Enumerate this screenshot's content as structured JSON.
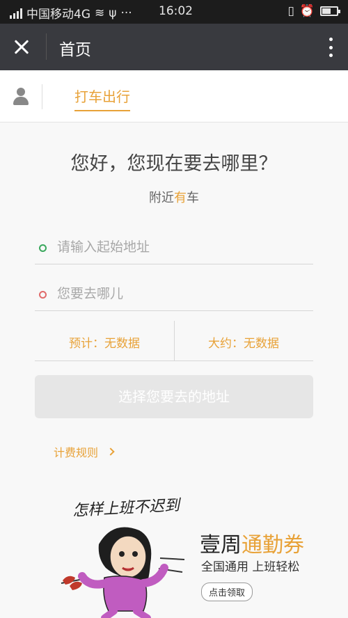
{
  "status_bar": {
    "carrier": "中国移动4G",
    "time": "16:02"
  },
  "title_bar": {
    "title": "首页"
  },
  "tabs": [
    {
      "label": "打车出行",
      "active": true
    }
  ],
  "main": {
    "greeting": "您好，您现在要去哪里？",
    "nearby_prefix": "附近",
    "nearby_highlight": "有",
    "nearby_suffix": "车",
    "start_placeholder": "请输入起始地址",
    "destination_placeholder": "您要去哪儿",
    "estimate_label": "预计：无数据",
    "approx_label": "大约：无数据",
    "submit_label": "选择您要去的地址",
    "pricing_rules": "计费规则"
  },
  "banner": {
    "caption": "怎样上班不迟到",
    "title_prefix": "壹周",
    "title_highlight": "通勤券",
    "subtitle": "全国通用 上班轻松",
    "claim_button": "点击领取"
  },
  "colors": {
    "accent": "#e8a238",
    "start_dot": "#3aa85d",
    "end_dot": "#e06a6a",
    "titlebar_bg": "#393a3f",
    "statusbar_bg": "#1c1c1c"
  }
}
